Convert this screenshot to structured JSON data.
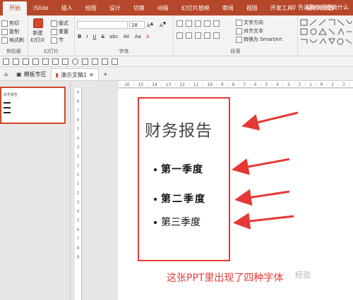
{
  "ribbon_tabs": [
    "开始",
    "iSlide",
    "插入",
    "绘图",
    "设计",
    "切换",
    "动画",
    "幻灯片放映",
    "审阅",
    "视图",
    "开发工具",
    "福昕阅读器"
  ],
  "tell_me": "告诉我你想要做什么",
  "clipboard": {
    "cut": "剪切",
    "copy": "复制",
    "format_painter": "格式刷",
    "label": "剪贴板"
  },
  "slides_group": {
    "new_slide": "新建\n幻灯片",
    "layout": "版式",
    "reset": "重置",
    "section": "节",
    "label": "幻灯片"
  },
  "font_group": {
    "size": "28",
    "label": "字体",
    "buttons": [
      "B",
      "I",
      "U",
      "S",
      "abc",
      "AV",
      "Aa",
      "A"
    ]
  },
  "paragraph_group": {
    "text_direction": "文字方向",
    "align_text": "对齐文本",
    "smartart": "转换为 SmartArt",
    "label": "段落"
  },
  "doc_tabs": [
    {
      "label": "模板专区"
    },
    {
      "label": "演示文稿1"
    }
  ],
  "ruler_top": "· 16 · 15 · 14 · 13 · 12 · 11 · 10 · 9 · 8 · 7 · 6 · 5 · 4 · 3 · 2 · 1 · 0 · 1 · 2 · 3",
  "ruler_left": [
    "9",
    "8",
    "7",
    "6",
    "5",
    "4",
    "3",
    "2",
    "1",
    "0",
    "1",
    "2",
    "3",
    "4",
    "5",
    "6",
    "7",
    "8",
    "9"
  ],
  "thumbnail": {
    "title": "财务报告"
  },
  "slide": {
    "title": "财务报告",
    "bullets": [
      "第一季度",
      "第二季度",
      "第三季度"
    ]
  },
  "caption": "这张PPT里出现了四种字体",
  "watermark": "经验",
  "colors": {
    "accent": "#b7472a",
    "annotation": "#e53935"
  }
}
